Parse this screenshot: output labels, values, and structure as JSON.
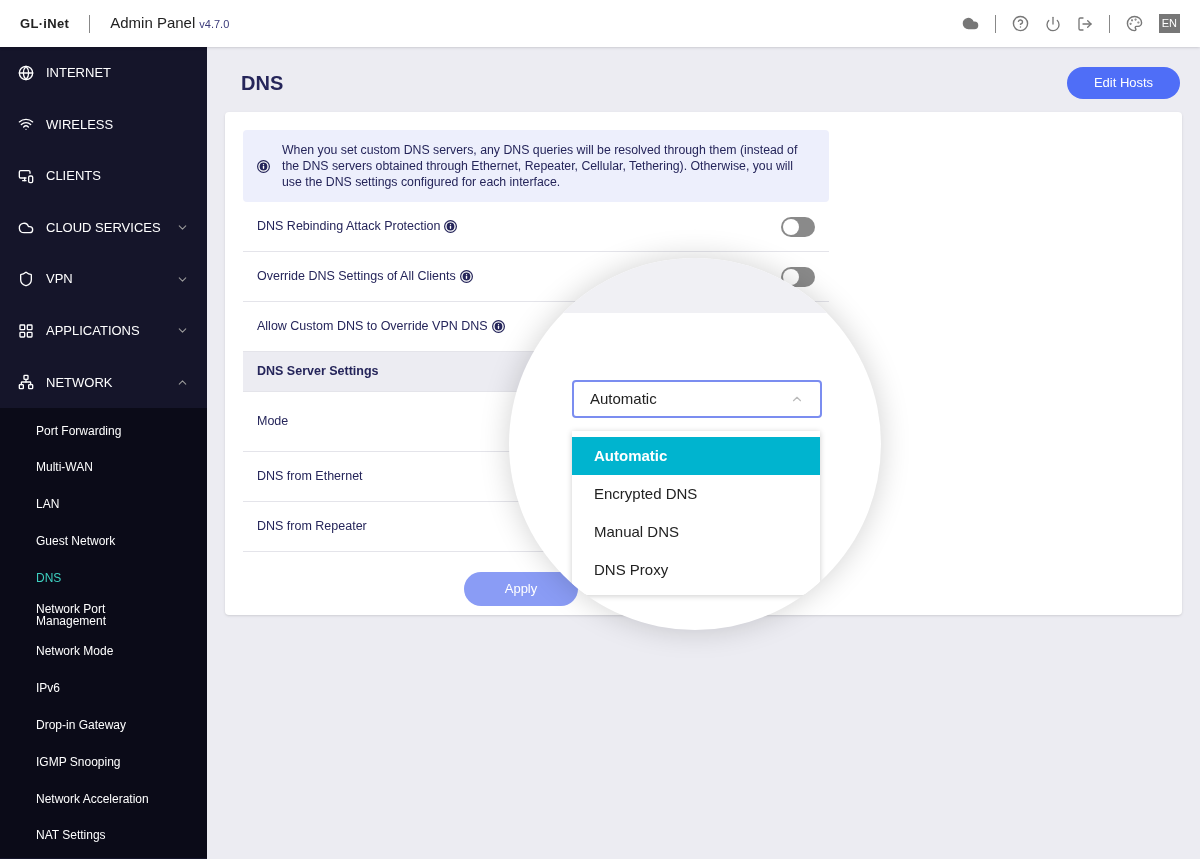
{
  "header": {
    "logo": "GL·iNet",
    "title": "Admin Panel",
    "version": "v4.7.0",
    "language": "EN"
  },
  "sidebar": {
    "items": [
      {
        "label": "INTERNET"
      },
      {
        "label": "WIRELESS"
      },
      {
        "label": "CLIENTS"
      },
      {
        "label": "CLOUD SERVICES",
        "expanded": false
      },
      {
        "label": "VPN",
        "expanded": false
      },
      {
        "label": "APPLICATIONS",
        "expanded": false
      },
      {
        "label": "NETWORK",
        "expanded": true,
        "children": [
          {
            "label": "Port Forwarding",
            "selected": false
          },
          {
            "label": "Multi-WAN",
            "selected": false
          },
          {
            "label": "LAN",
            "selected": false
          },
          {
            "label": "Guest Network",
            "selected": false
          },
          {
            "label": "DNS",
            "selected": true
          },
          {
            "label": "Network Port Management",
            "selected": false
          },
          {
            "label": "Network Mode",
            "selected": false
          },
          {
            "label": "IPv6",
            "selected": false
          },
          {
            "label": "Drop-in Gateway",
            "selected": false
          },
          {
            "label": "IGMP Snooping",
            "selected": false
          },
          {
            "label": "Network Acceleration",
            "selected": false
          },
          {
            "label": "NAT Settings",
            "selected": false
          }
        ]
      }
    ]
  },
  "page": {
    "title": "DNS",
    "edit_hosts_button": "Edit Hosts",
    "notice": "When you set custom DNS servers, any DNS queries will be resolved through them (instead of the DNS servers obtained through Ethernet, Repeater, Cellular, Tethering). Otherwise, you will use the DNS settings configured for each interface.",
    "rows": [
      {
        "kind": "toggle",
        "label": "DNS Rebinding Attack Protection",
        "info": true,
        "on": false
      },
      {
        "kind": "toggle",
        "label": "Override DNS Settings of All Clients",
        "info": true,
        "on": false
      },
      {
        "kind": "plain",
        "label": "Allow Custom DNS to Override VPN DNS",
        "info": true
      },
      {
        "kind": "section",
        "label": "DNS Server Settings"
      },
      {
        "kind": "plain",
        "label": "Mode"
      },
      {
        "kind": "plain",
        "label": "DNS from Ethernet"
      },
      {
        "kind": "plain",
        "label": "DNS from Repeater"
      }
    ],
    "apply_button": "Apply",
    "mode_select": {
      "value": "Automatic",
      "expanded": true,
      "options": [
        {
          "label": "Automatic",
          "selected": true
        },
        {
          "label": "Encrypted DNS",
          "selected": false
        },
        {
          "label": "Manual DNS",
          "selected": false
        },
        {
          "label": "DNS Proxy",
          "selected": false
        }
      ]
    }
  }
}
